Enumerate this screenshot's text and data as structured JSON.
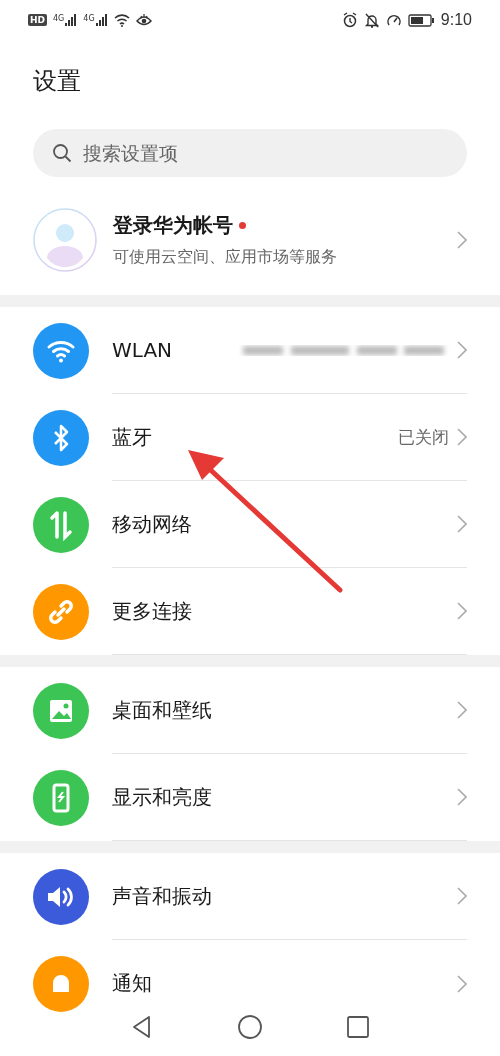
{
  "status_bar": {
    "hd": "HD",
    "networks": [
      "4G",
      "4G"
    ],
    "time": "9:10"
  },
  "title": "设置",
  "search": {
    "placeholder": "搜索设置项"
  },
  "account": {
    "title": "登录华为帐号",
    "notification_dot": true,
    "subtitle": "可使用云空间、应用市场等服务"
  },
  "groups": [
    {
      "items": [
        {
          "label": "WLAN",
          "kind": "wifi",
          "color": "#2196f3",
          "redacted": true
        },
        {
          "label": "蓝牙",
          "kind": "bluetooth",
          "color": "#2196f3",
          "value": "已关闭"
        },
        {
          "label": "移动网络",
          "kind": "arrows",
          "color": "#3cc454"
        },
        {
          "label": "更多连接",
          "kind": "link",
          "color": "#ff9800"
        }
      ]
    },
    {
      "items": [
        {
          "label": "桌面和壁纸",
          "kind": "image",
          "color": "#3cc454"
        },
        {
          "label": "显示和亮度",
          "kind": "phone",
          "color": "#3cc454"
        }
      ]
    },
    {
      "items": [
        {
          "label": "声音和振动",
          "kind": "speaker",
          "color": "#3b5bdb"
        },
        {
          "label": "通知",
          "kind": "bell",
          "color": "#ff9800"
        }
      ]
    }
  ],
  "annotation": {
    "kind": "arrow",
    "color": "#e53935"
  }
}
